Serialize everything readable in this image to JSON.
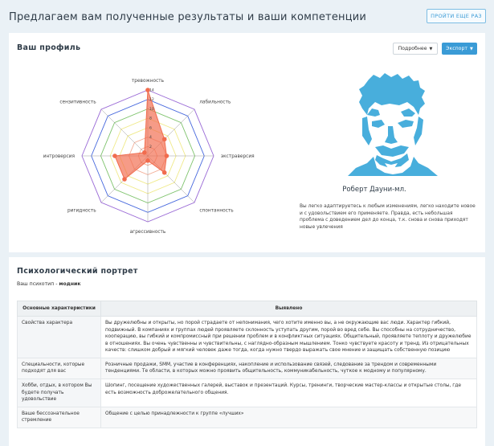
{
  "header": {
    "title": "Предлагаем вам полученные результаты и ваши компетенции",
    "retry_label": "ПРОЙТИ ЕЩЕ РАЗ"
  },
  "profile": {
    "title": "Ваш профиль",
    "more_label": "Подробнее",
    "export_label": "Экспорт",
    "celebrity_name": "Роберт Дауни-мл.",
    "celebrity_description": "Вы легко адаптируетесь к любым изменениям, легко находите новое и с удовольствием его применяете. Правда, есть небольшая проблема с доведением дел до конца, т.к. снова и снова приходят новые увлечения"
  },
  "chart_data": {
    "type": "radar",
    "categories": [
      "тревожность",
      "лабильность",
      "экстраверсия",
      "спонтанность",
      "агрессивность",
      "ригидность",
      "интроверсия",
      "сензитивность"
    ],
    "values": [
      14,
      5,
      4,
      5,
      1,
      7,
      7,
      1
    ],
    "max": 14,
    "rings": [
      2,
      4,
      6,
      8,
      10,
      12,
      14
    ],
    "tick_labels": [
      "2",
      "4",
      "6",
      "8",
      "10",
      "12",
      "14"
    ],
    "ring_colors": [
      "#f3ad96",
      "#f3ad96",
      "#f0ea8a",
      "#f0ea8a",
      "#7ec36c",
      "#4466dd",
      "#9a6ad6"
    ],
    "fill_color": "#f16c4e"
  },
  "portrait": {
    "title": "Психологический портрет",
    "psychotype_label": "Ваш психотип -",
    "psychotype_value": "модник",
    "table": {
      "headers": [
        "Основные характеристики",
        "Выявлено"
      ],
      "rows": [
        [
          "Свойства характера",
          "Вы дружелюбны и открыты, но порой страдаете от непонимания, чего хотите именно вы, а не окружающие вас люди. Характер гибкий, подвижный. В компаниях и группах людей проявляете склонность уступать другим, порой во вред себе. Вы способны на сотрудничество, кооперацию, вы гибкий и компромиссный при решении проблем и в конфликтных ситуациях. Общительный, проявляете теплоту и дружелюбие в отношениях. Вы очень чувственны и чувствительны, с наглядно-образным мышлением. Тонко чувствуете красоту и тренд. Из отрицательных качеств: слишком добрый и мягкий человек даже тогда, когда нужно твердо выражать свое мнение и защищать собственную позицию"
        ],
        [
          "Специальности, которые подходят для вас",
          "Розничные продажи, SMM, участие в конференциях, накопление и использование связей, следование за трендом и современными тенденциями. Те области, в которых можно проявить общительность, коммуникабельность, чуткое к модному и популярному."
        ],
        [
          "Хобби, отдых, в котором Вы будете получать удовольствие",
          "Шопинг, посещение художественных галерей, выставок и презентаций. Курсы, тренинги, творческие мастер-классы и открытые столы, где есть возможность доброжелательного общения."
        ],
        [
          "Ваше бессознательное стремление",
          "Общение с целью принадлежности к группе «лучших»"
        ]
      ]
    }
  }
}
